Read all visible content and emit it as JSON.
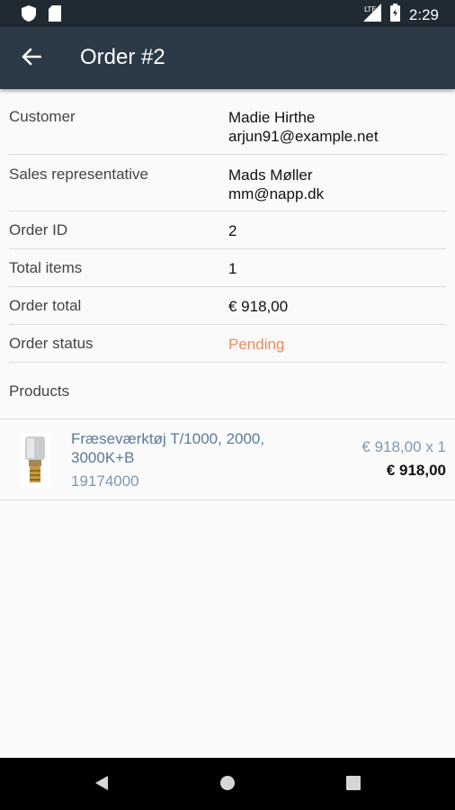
{
  "status_bar": {
    "time": "2:29",
    "icons": [
      "shield-icon",
      "sim-card-icon",
      "lte-signal-icon",
      "battery-icon"
    ]
  },
  "app_bar": {
    "title": "Order #2",
    "back_icon": "arrow-left-icon"
  },
  "details": {
    "customer": {
      "label": "Customer",
      "name": "Madie Hirthe",
      "email": "arjun91@example.net"
    },
    "sales_rep": {
      "label": "Sales representative",
      "name": "Mads Møller",
      "email": "mm@napp.dk"
    },
    "order_id": {
      "label": "Order ID",
      "value": "2"
    },
    "total_items": {
      "label": "Total items",
      "value": "1"
    },
    "order_total": {
      "label": "Order total",
      "value": "€ 918,00"
    },
    "order_status": {
      "label": "Order status",
      "value": "Pending",
      "color": "#f08a5d"
    }
  },
  "products": {
    "label": "Products",
    "items": [
      {
        "name": "Fræseværktøj T/1000, 2000, 3000K+B",
        "sku": "19174000",
        "unit_price": "€ 918,00 x 1",
        "line_total": "€ 918,00"
      }
    ]
  },
  "colors": {
    "appbar": "#2c3a47",
    "statusbar": "#202a33",
    "link_blue": "#5b7a99",
    "pending": "#f08a5d"
  },
  "nav_bar": {
    "icons": [
      "back-triangle-icon",
      "home-circle-icon",
      "recents-square-icon"
    ]
  }
}
